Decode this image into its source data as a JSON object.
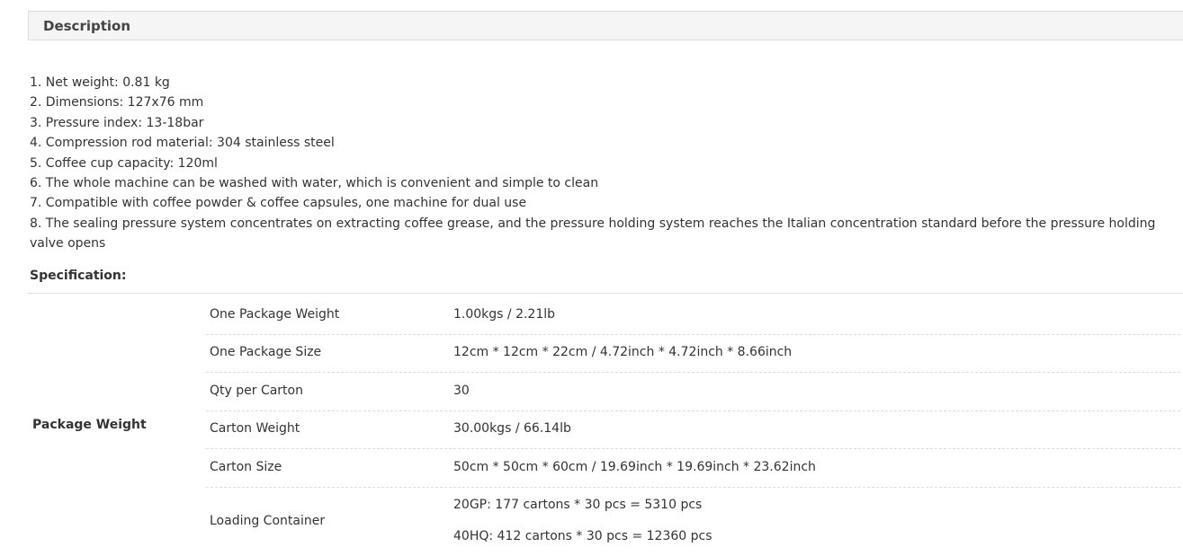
{
  "description": {
    "header": "Description",
    "features": [
      "1. Net weight: 0.81 kg",
      "2. Dimensions: 127x76 mm",
      "3. Pressure index: 13-18bar",
      "4. Compression rod material: 304 stainless steel",
      "5. Coffee cup capacity: 120ml",
      "6. The whole machine can be washed with water, which is convenient and simple to clean",
      "7. Compatible with coffee powder & coffee capsules, one machine for dual use",
      "8. The sealing pressure system concentrates on extracting coffee grease, and the pressure holding system reaches the Italian concentration standard before the pressure holding valve opens"
    ]
  },
  "specification": {
    "title": "Specification:",
    "group_label": "Package Weight",
    "rows": [
      {
        "key": "One Package Weight",
        "value": "1.00kgs / 2.21lb"
      },
      {
        "key": "One Package Size",
        "value": "12cm * 12cm * 22cm / 4.72inch * 4.72inch * 8.66inch"
      },
      {
        "key": "Qty per Carton",
        "value": "30"
      },
      {
        "key": "Carton Weight",
        "value": "30.00kgs / 66.14lb"
      },
      {
        "key": "Carton Size",
        "value": "50cm * 50cm * 60cm / 19.69inch * 19.69inch * 23.62inch"
      }
    ],
    "loading": {
      "key": "Loading Container",
      "values": [
        "20GP: 177 cartons * 30 pcs = 5310 pcs",
        "40HQ: 412 cartons * 30 pcs = 12360 pcs"
      ]
    }
  }
}
